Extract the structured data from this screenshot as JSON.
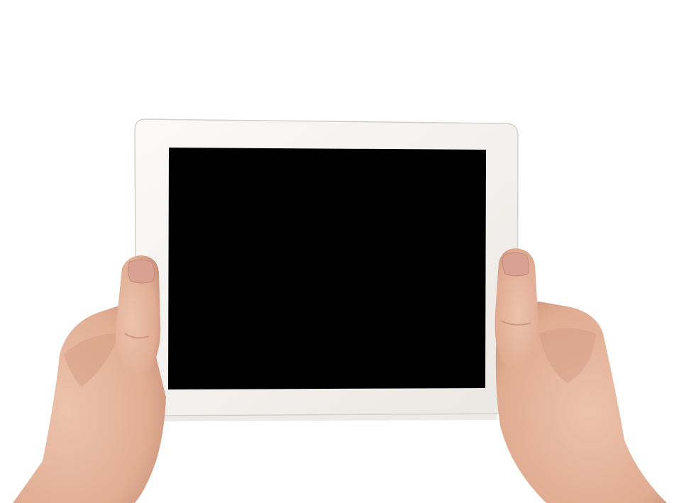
{
  "scene": {
    "background_color": "#ffffff",
    "tablet": {
      "frame_color": "#f4f1ee",
      "frame_edge_color": "#d9d4cf",
      "screen_color": "#000000",
      "screen_state": "off"
    },
    "hands": {
      "skin_color": "#e4b59d",
      "skin_shadow_color": "#c78f76",
      "nail_color": "#d79f93"
    }
  }
}
